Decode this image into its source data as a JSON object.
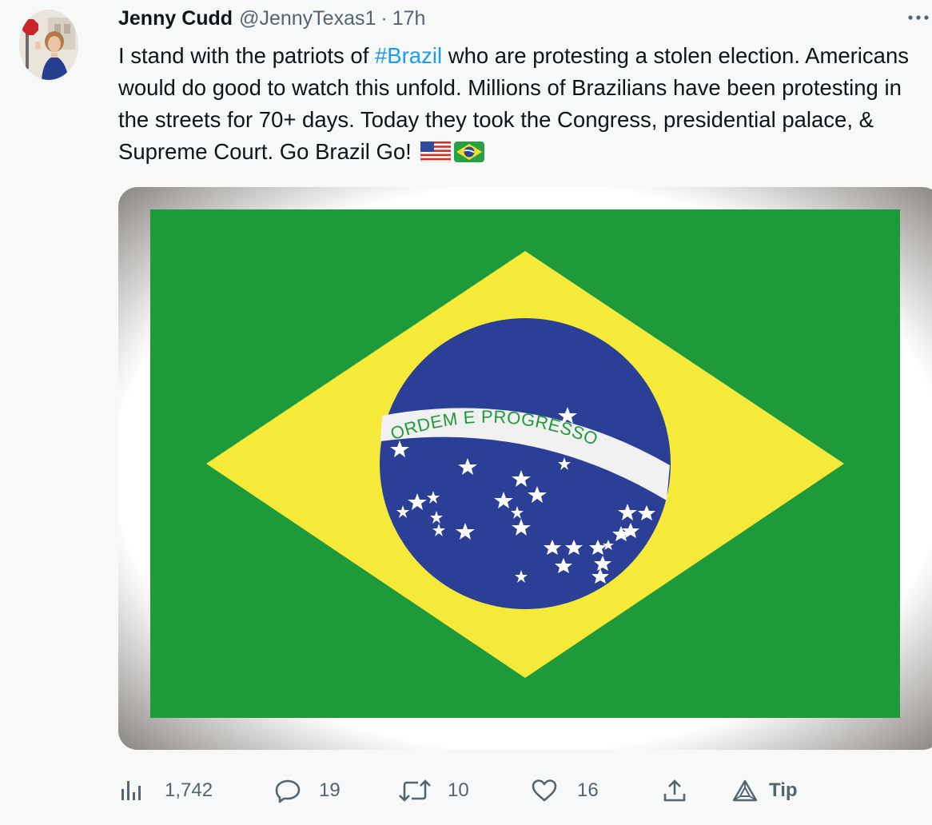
{
  "tweet": {
    "author_name": "Jenny Cudd",
    "handle": "@JennyTexas1",
    "separator": "·",
    "time": "17h",
    "more_label": "···",
    "text_before": "I stand with the patriots of ",
    "hashtag": "#Brazil",
    "text_after": " who are protesting a stolen election. Americans would do good to watch this unfold. Millions of Brazilians have been protesting in the streets for 70+ days. Today they took the Congress, presidential palace, & Supreme Court. Go Brazil Go!",
    "emojis": [
      "us-flag-emoji",
      "brazil-flag-emoji"
    ]
  },
  "media": {
    "description_icon": "brazil-flag-image",
    "motto": "ORDEM E PROGRESSO",
    "colors": {
      "green": "#1f9a3a",
      "yellow": "#f5ea3a",
      "blue": "#2a3f95",
      "white": "#f3f3f3",
      "band_text": "#1e9a3a"
    }
  },
  "actions": {
    "views": {
      "icon": "views-chart-icon",
      "count": "1,742"
    },
    "replies": {
      "icon": "reply-icon",
      "count": "19"
    },
    "retweets": {
      "icon": "retweet-icon",
      "count": "10"
    },
    "likes": {
      "icon": "heart-icon",
      "count": "16"
    },
    "share": {
      "icon": "share-icon"
    },
    "tip": {
      "icon": "tip-icon",
      "label": "Tip"
    }
  },
  "colors": {
    "text": "#0f1419",
    "secondary": "#536471",
    "link": "#1d9bf0",
    "background": "#f7f9f9"
  }
}
